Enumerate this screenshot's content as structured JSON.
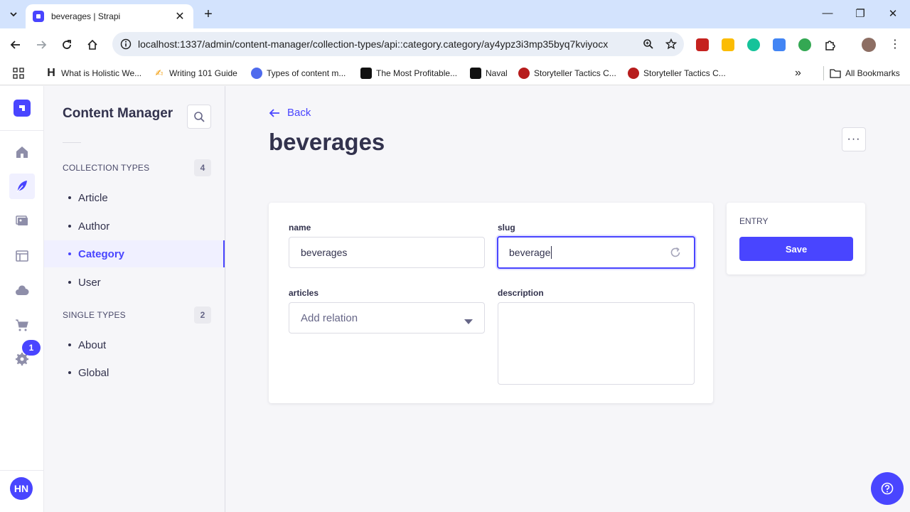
{
  "browser": {
    "tab_title": "beverages | Strapi",
    "url": "localhost:1337/admin/content-manager/collection-types/api::category.category/ay4ypz3i3mp35byq7kviyocx",
    "bookmarks": [
      {
        "label": "What is Holistic We...",
        "icon": "h-letter-icon"
      },
      {
        "label": "Writing 101 Guide",
        "icon": "pencil-hand-icon"
      },
      {
        "label": "Types of content m...",
        "icon": "blue-circle-icon"
      },
      {
        "label": "The Most Profitable...",
        "icon": "dark-square-icon"
      },
      {
        "label": "Naval",
        "icon": "dark-square-icon"
      },
      {
        "label": "Storyteller Tactics C...",
        "icon": "red-badge-icon"
      },
      {
        "label": "Storyteller Tactics C...",
        "icon": "red-badge-icon"
      }
    ],
    "all_bookmarks": "All Bookmarks"
  },
  "sidebar": {
    "title": "Content Manager",
    "collection_header": "COLLECTION TYPES",
    "collection_count": "4",
    "collection_items": [
      "Article",
      "Author",
      "Category",
      "User"
    ],
    "active_item": "Category",
    "single_header": "SINGLE TYPES",
    "single_count": "2",
    "single_items": [
      "About",
      "Global"
    ]
  },
  "rail": {
    "settings_badge": "1",
    "avatar_initials": "HN"
  },
  "main": {
    "back_label": "Back",
    "title": "beverages",
    "more_label": "···",
    "fields": {
      "name_label": "name",
      "name_value": "beverages",
      "slug_label": "slug",
      "slug_value": "beverage",
      "articles_label": "articles",
      "articles_placeholder": "Add relation",
      "description_label": "description"
    },
    "entry": {
      "header": "ENTRY",
      "save_label": "Save"
    }
  },
  "colors": {
    "primary": "#4945ff",
    "text": "#32324d",
    "border": "#dcdce4"
  }
}
